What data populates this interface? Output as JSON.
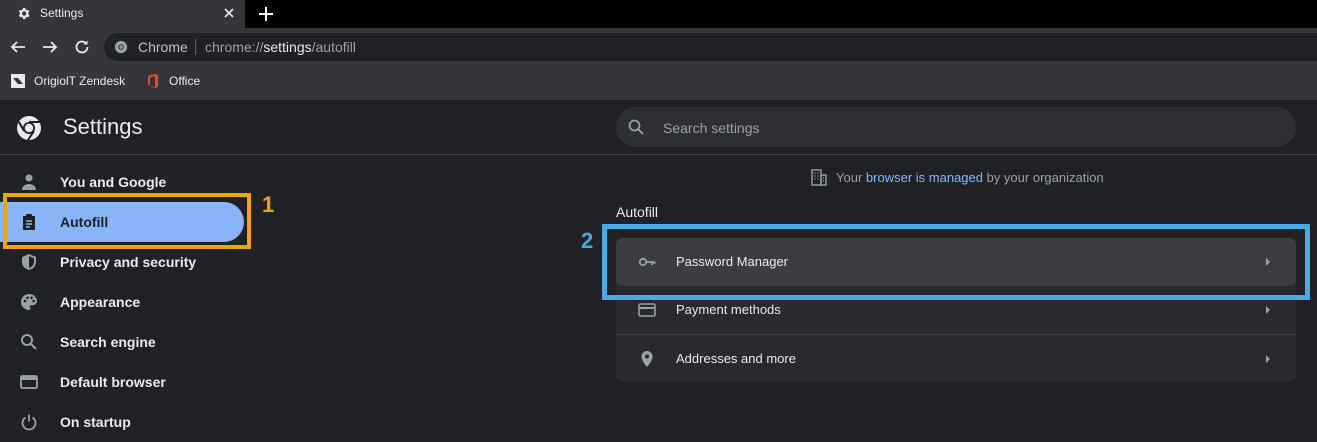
{
  "tab": {
    "title": "Settings"
  },
  "omnibox": {
    "chip": "Chrome",
    "url_prefix": "chrome://",
    "url_bold": "settings",
    "url_suffix": "/autofill"
  },
  "bookmarks": [
    {
      "label": "OrigiolT Zendesk",
      "icon": "zendesk-icon"
    },
    {
      "label": "Office",
      "icon": "office-icon"
    }
  ],
  "header": {
    "title": "Settings",
    "search_placeholder": "Search settings"
  },
  "sidebar": {
    "items": [
      {
        "label": "You and Google",
        "icon": "person-icon"
      },
      {
        "label": "Autofill",
        "icon": "clipboard-icon",
        "active": true
      },
      {
        "label": "Privacy and security",
        "icon": "shield-icon"
      },
      {
        "label": "Appearance",
        "icon": "palette-icon"
      },
      {
        "label": "Search engine",
        "icon": "search-icon"
      },
      {
        "label": "Default browser",
        "icon": "browser-icon"
      },
      {
        "label": "On startup",
        "icon": "power-icon"
      }
    ]
  },
  "managed": {
    "prefix": "Your",
    "link": "browser is managed",
    "suffix": "by your organization"
  },
  "section": {
    "title": "Autofill"
  },
  "autofill_rows": [
    {
      "label": "Password Manager",
      "icon": "key-icon"
    },
    {
      "label": "Payment methods",
      "icon": "credit-card-icon"
    },
    {
      "label": "Addresses and more",
      "icon": "location-pin-icon"
    }
  ],
  "annotations": {
    "marker_1": "1",
    "marker_2": "2"
  },
  "colors": {
    "accent": "#8ab4f8",
    "highlight_1": "#f0a30a",
    "highlight_2": "#4aa9e0",
    "background": "#202124"
  }
}
